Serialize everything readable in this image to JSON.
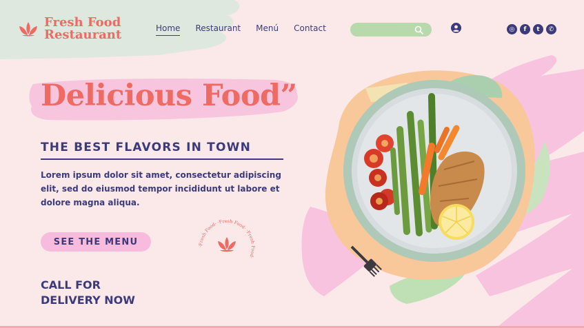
{
  "brand": {
    "name_line1": "Fresh Food",
    "name_line2": "Restaurant",
    "color": "#ef6a62"
  },
  "nav": {
    "items": [
      {
        "label": "Home",
        "active": true
      },
      {
        "label": "Restaurant",
        "active": false
      },
      {
        "label": "Menú",
        "active": false
      },
      {
        "label": "Contact",
        "active": false
      }
    ]
  },
  "search": {
    "placeholder": "",
    "icon": "search-icon"
  },
  "user": {
    "icon": "user-icon"
  },
  "socials": [
    {
      "name": "instagram-icon",
      "glyph": "◎"
    },
    {
      "name": "facebook-icon",
      "glyph": "f"
    },
    {
      "name": "twitter-icon",
      "glyph": "t"
    },
    {
      "name": "whatsapp-icon",
      "glyph": "✆"
    }
  ],
  "hero": {
    "title": "Delicious Food”",
    "subtitle": "THE BEST FLAVORS IN TOWN",
    "description": "Lorem ipsum dolor sit amet, consectetur adipiscing elit, sed do eiusmod tempor incididunt ut labore et dolore magna aliqua.",
    "cta_label": "SEE THE MENU",
    "delivery_line1": "CALL FOR",
    "delivery_line2": "DELIVERY NOW"
  },
  "stamp": {
    "ring_text": "·Fresh Food· ·Fresh Food· ·Fresh Food·"
  },
  "colors": {
    "background": "#fbe9ea",
    "navy": "#3b3a7a",
    "coral": "#ef6a62",
    "mint": "#b8d9ab",
    "pink": "#f7bcdd",
    "peach": "#f8c79a"
  }
}
